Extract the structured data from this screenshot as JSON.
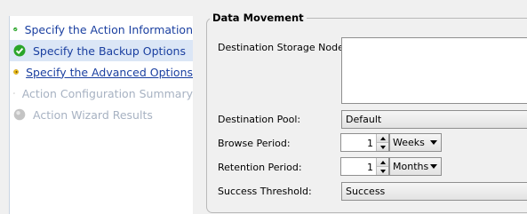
{
  "wizard_steps": [
    {
      "label": "Specify the Action Information",
      "status": "done",
      "icon": "check-icon"
    },
    {
      "label": "Specify the Backup Options",
      "status": "done",
      "icon": "check-icon"
    },
    {
      "label": "Specify the Advanced Options",
      "status": "current",
      "icon": "arrow-right-icon"
    },
    {
      "label": "Action Configuration Summary",
      "status": "pending",
      "icon": "pending-circle-icon"
    },
    {
      "label": "Action Wizard Results",
      "status": "pending",
      "icon": "pending-circle-icon"
    }
  ],
  "data_movement": {
    "title": "Data Movement",
    "destination_storage_node_label": "Destination Storage Node:",
    "destination_storage_node_value": "",
    "destination_pool_label": "Destination Pool:",
    "destination_pool_value": "Default",
    "browse_period_label": "Browse Period:",
    "browse_period_value": "1",
    "browse_period_unit": "Weeks",
    "retention_period_label": "Retention Period:",
    "retention_period_value": "1",
    "retention_period_unit": "Months",
    "success_threshold_label": "Success Threshold:",
    "success_threshold_value": "Success"
  },
  "colors": {
    "check_green": "#2aa52a",
    "current_yellow": "#f3c21c",
    "pending_grey": "#b9b9b9",
    "link_blue": "#1a3fa0"
  }
}
